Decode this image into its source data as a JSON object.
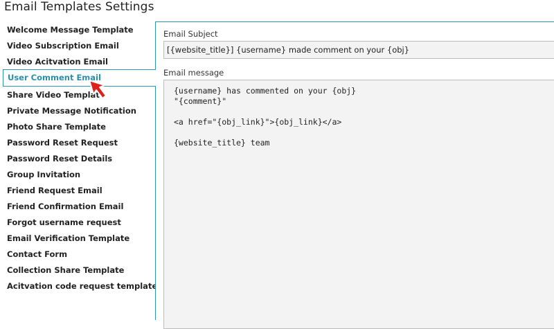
{
  "page": {
    "title": "Email Templates Settings"
  },
  "sidebar": {
    "active_index": 3,
    "items": [
      {
        "label": "Welcome Message Template"
      },
      {
        "label": "Video Subscription Email"
      },
      {
        "label": "Video Acitvation Email"
      },
      {
        "label": "User Comment Email"
      },
      {
        "label": "Share Video Template"
      },
      {
        "label": "Private Message Notification"
      },
      {
        "label": "Photo Share Template"
      },
      {
        "label": "Password Reset Request"
      },
      {
        "label": "Password Reset Details"
      },
      {
        "label": "Group Invitation"
      },
      {
        "label": "Friend Request Email"
      },
      {
        "label": "Friend Confirmation Email"
      },
      {
        "label": "Forgot username request"
      },
      {
        "label": "Email Verification Template"
      },
      {
        "label": "Contact Form"
      },
      {
        "label": "Collection Share Template"
      },
      {
        "label": "Acitvation code request template"
      }
    ]
  },
  "form": {
    "subject_label": "Email Subject",
    "subject_value": "[{website_title}] {username} made comment on your {obj}",
    "message_label": "Email message",
    "message_value": "{username} has commented on your {obj}\n\"{comment}\"\n\n<a href=\"{obj_link}\">{obj_link}</a>\n\n{website_title} team"
  },
  "colors": {
    "accent": "#2a96ad",
    "active_text": "#2a8fa8",
    "input_bg": "#f3f3f3",
    "pointer": "#e0201b"
  },
  "icons": {
    "pointer": "red-arrow-cursor-icon"
  }
}
